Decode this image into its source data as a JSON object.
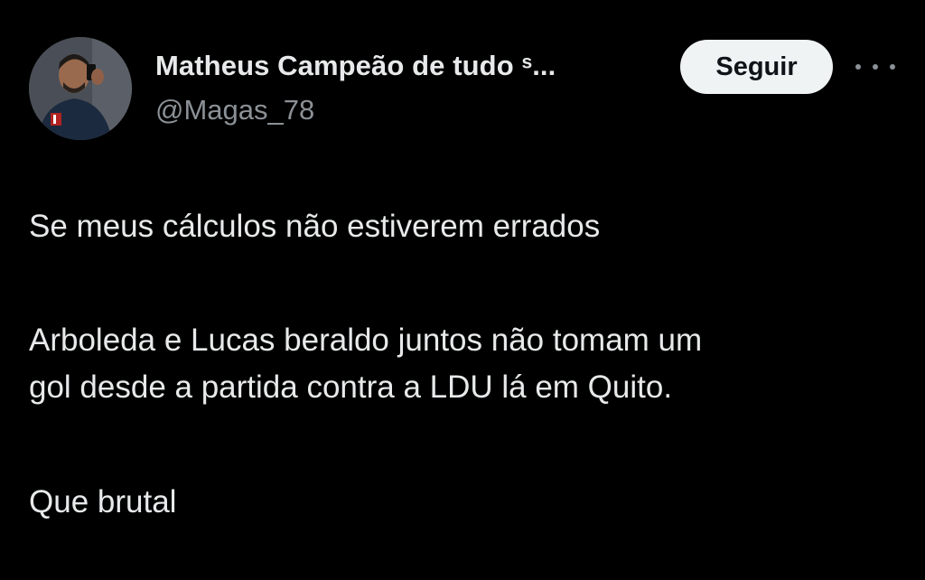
{
  "author": {
    "display_name": "Matheus Campeão de tudo ˢ...",
    "handle": "@Magas_78"
  },
  "actions": {
    "follow_label": "Seguir",
    "more_icon": "more-horizontal-icon"
  },
  "tweet": {
    "paragraph_1": "Se meus cálculos não estiverem errados",
    "paragraph_2_line_1": "Arboleda e Lucas beraldo juntos não tomam um",
    "paragraph_2_line_2": "gol desde a partida contra a LDU lá em Quito.",
    "paragraph_3": "Que brutal"
  },
  "colors": {
    "background": "#000000",
    "primary_text": "#e7e9ea",
    "secondary_text": "#8b9196",
    "follow_button_bg": "#eff3f4",
    "follow_button_text": "#0f1419"
  }
}
